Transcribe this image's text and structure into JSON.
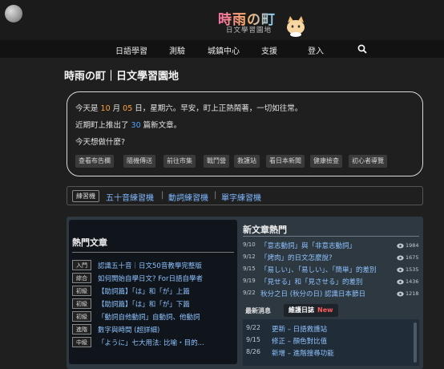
{
  "header": {
    "site_title": "時雨の町",
    "site_subtitle": "日文學習園地",
    "moon_icon": "moon-icon",
    "mascot_icon": "cat-mascot-icon"
  },
  "nav": {
    "items": [
      "日語學習",
      "測驗",
      "城鎮中心",
      "支援",
      "登入"
    ],
    "search_icon": "search-icon"
  },
  "page": {
    "title": "時雨の町｜日文學習園地"
  },
  "greeting": {
    "line1_prefix": "今天是 ",
    "month": "10",
    "month_suffix": " 月 ",
    "day": "05",
    "line1_suffix": " 日，星期六。早安，町上正熱鬧著，一切如往常。",
    "line2_prefix": "近期町上推出了 ",
    "new_count": "30",
    "line2_suffix": " 篇新文章。",
    "line3": "今天想做什麼?",
    "tags": [
      "查看布告欄",
      "隨機傳送",
      "前往市集",
      "戰鬥營",
      "救護站",
      "看日本新聞",
      "健康檢查",
      "初心者導覽"
    ]
  },
  "practice": {
    "label": "練習機",
    "links": [
      "五十音練習機",
      "動詞練習機",
      "單字練習機"
    ],
    "separator": "|"
  },
  "hot": {
    "title": "熱門文章",
    "items": [
      {
        "level": "入門",
        "text": "認識五十音｜日文50音教學完整版"
      },
      {
        "level": "綜合",
        "text": "如何開始自學日文? For日語自學者"
      },
      {
        "level": "初級",
        "text": "【助詞篇】「は」和「が」上篇"
      },
      {
        "level": "初級",
        "text": "【助詞篇】「は」和「が」下篇"
      },
      {
        "level": "初級",
        "text": "「動詞自他動詞」自動詞、他動詞"
      },
      {
        "level": "進階",
        "text": "數字與時間 (超詳細)"
      },
      {
        "level": "中級",
        "text": "「ように」七大用法: 比喻・目的..."
      }
    ]
  },
  "new_articles": {
    "title": "新文章熱門",
    "items": [
      {
        "date": "9/10",
        "text": "「意志動詞」與「非意志動詞」",
        "views": "1984"
      },
      {
        "date": "9/12",
        "text": "「烤肉」的日文怎麼說?",
        "views": "1675"
      },
      {
        "date": "9/15",
        "text": "「易しい」、「易しい」、「簡単」的差別",
        "views": "1535"
      },
      {
        "date": "9/19",
        "text": "「見せる」和「見させる」的差別",
        "views": "1436"
      },
      {
        "date": "9/22",
        "text": "秋分之日 (秋分の日) 認識日本節日",
        "views": "1218"
      }
    ],
    "eye_icon": "eye-icon"
  },
  "log": {
    "tab_news": "最新消息",
    "tab_log": "維護日誌",
    "new_badge": "New",
    "items": [
      {
        "date": "9/22",
        "text": "更新 – 日語救護站"
      },
      {
        "date": "9/15",
        "text": "修正 – 顏色對比值"
      },
      {
        "date": "8/26",
        "text": "新增 – 進階搜尋功能"
      }
    ]
  },
  "colors": {
    "accent_orange": "#ffa43a",
    "accent_blue": "#4ea3ff",
    "link": "#8fc3ff"
  }
}
